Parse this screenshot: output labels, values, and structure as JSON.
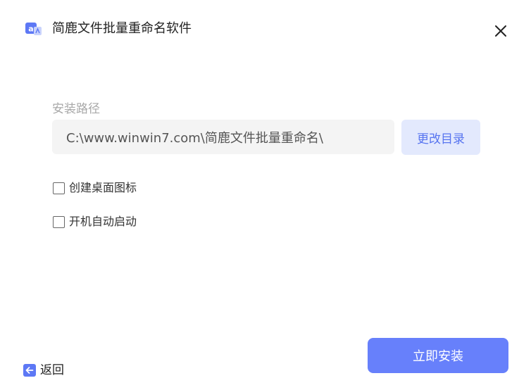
{
  "header": {
    "app_icon": "app-logo-icon",
    "title": "简鹿文件批量重命名软件",
    "close_icon": "close-icon"
  },
  "install_path": {
    "label": "安装路径",
    "value": "C:\\www.winwin7.com\\简鹿文件批量重命名\\",
    "change_button_label": "更改目录"
  },
  "options": {
    "desktop_shortcut": {
      "label": "创建桌面图标",
      "checked": false
    },
    "auto_start": {
      "label": "开机自动启动",
      "checked": false
    }
  },
  "footer": {
    "back_icon": "arrow-left-icon",
    "back_label": "返回",
    "install_button_label": "立即安装"
  },
  "colors": {
    "accent": "#6780fb",
    "accent_light": "#e3e9fd",
    "accent_text": "#5774f0",
    "input_bg": "#f4f4f4",
    "label_gray": "#a8a8a8"
  }
}
